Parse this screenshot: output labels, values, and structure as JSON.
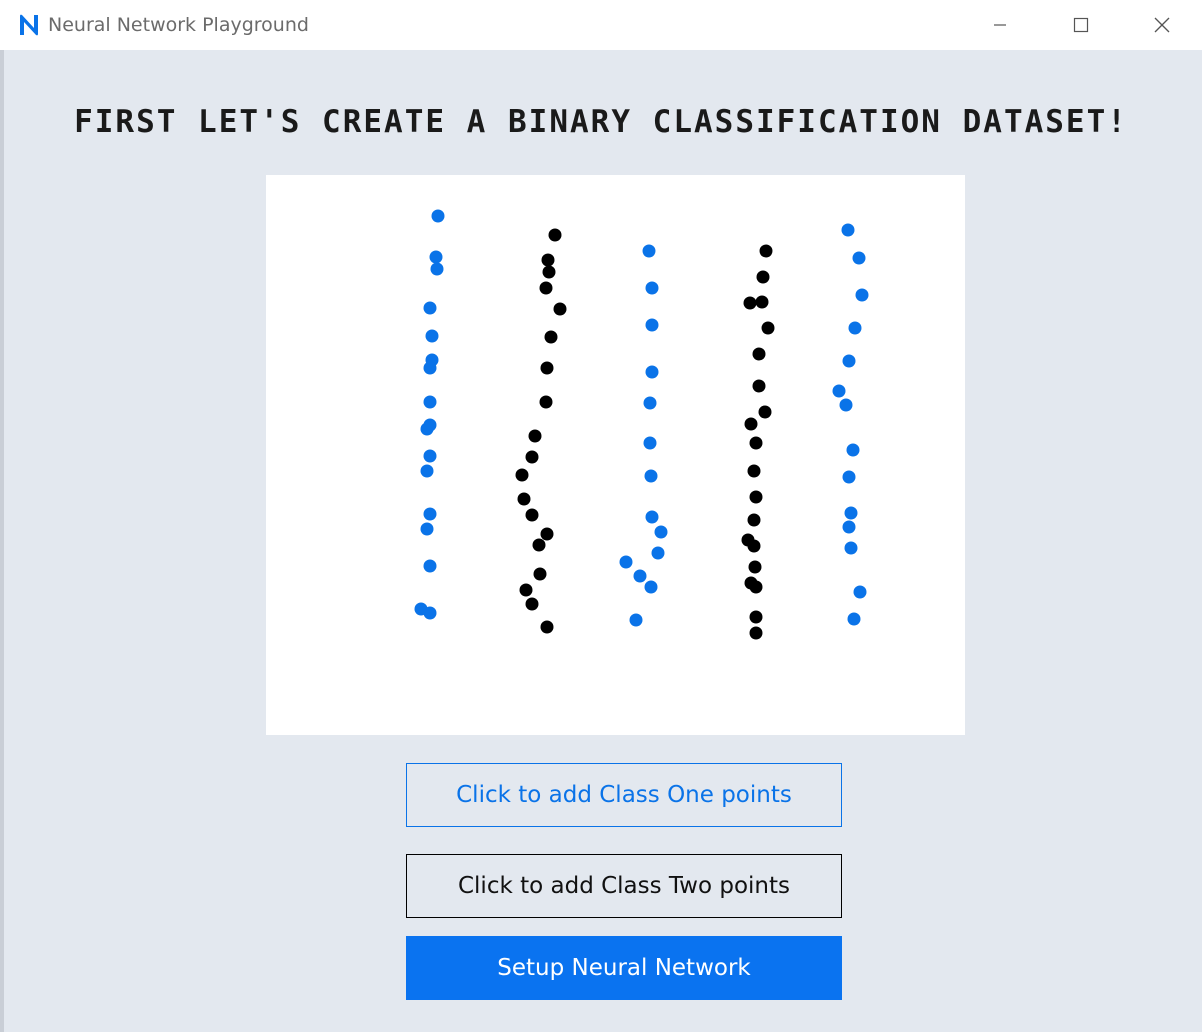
{
  "window": {
    "title": "Neural Network Playground",
    "icon": "app-n-icon",
    "controls": [
      "minimize-icon",
      "maximize-icon",
      "close-icon"
    ]
  },
  "heading": "FIRST LET'S CREATE A BINARY CLASSIFICATION DATASET!",
  "colors": {
    "class_one": "#0a73e8",
    "class_two": "#000000",
    "accent": "#0a73f0",
    "background": "#e3e8ef"
  },
  "dataset": {
    "class_one_points": [
      [
        438,
        216
      ],
      [
        436,
        257
      ],
      [
        437,
        269
      ],
      [
        430,
        308
      ],
      [
        432,
        336
      ],
      [
        432,
        360
      ],
      [
        430,
        368
      ],
      [
        430,
        402
      ],
      [
        430,
        425
      ],
      [
        427,
        429
      ],
      [
        430,
        456
      ],
      [
        427,
        471
      ],
      [
        430,
        514
      ],
      [
        427,
        529
      ],
      [
        430,
        566
      ],
      [
        421,
        609
      ],
      [
        430,
        613
      ],
      [
        649,
        251
      ],
      [
        652,
        288
      ],
      [
        652,
        325
      ],
      [
        652,
        372
      ],
      [
        650,
        403
      ],
      [
        650,
        443
      ],
      [
        651,
        476
      ],
      [
        652,
        517
      ],
      [
        661,
        532
      ],
      [
        658,
        553
      ],
      [
        626,
        562
      ],
      [
        640,
        576
      ],
      [
        651,
        587
      ],
      [
        636,
        620
      ],
      [
        848,
        230
      ],
      [
        859,
        258
      ],
      [
        862,
        295
      ],
      [
        855,
        328
      ],
      [
        849,
        361
      ],
      [
        839,
        391
      ],
      [
        846,
        405
      ],
      [
        853,
        450
      ],
      [
        849,
        477
      ],
      [
        851,
        513
      ],
      [
        849,
        527
      ],
      [
        851,
        548
      ],
      [
        860,
        592
      ],
      [
        854,
        619
      ]
    ],
    "class_two_points": [
      [
        555,
        235
      ],
      [
        548,
        260
      ],
      [
        549,
        272
      ],
      [
        546,
        288
      ],
      [
        560,
        309
      ],
      [
        551,
        337
      ],
      [
        547,
        368
      ],
      [
        546,
        402
      ],
      [
        535,
        436
      ],
      [
        532,
        457
      ],
      [
        522,
        475
      ],
      [
        524,
        499
      ],
      [
        532,
        515
      ],
      [
        547,
        534
      ],
      [
        539,
        545
      ],
      [
        540,
        574
      ],
      [
        526,
        590
      ],
      [
        532,
        604
      ],
      [
        547,
        627
      ],
      [
        766,
        251
      ],
      [
        763,
        277
      ],
      [
        750,
        303
      ],
      [
        762,
        302
      ],
      [
        768,
        328
      ],
      [
        759,
        354
      ],
      [
        759,
        386
      ],
      [
        765,
        412
      ],
      [
        751,
        424
      ],
      [
        756,
        443
      ],
      [
        754,
        471
      ],
      [
        756,
        497
      ],
      [
        754,
        520
      ],
      [
        748,
        540
      ],
      [
        754,
        546
      ],
      [
        755,
        567
      ],
      [
        751,
        583
      ],
      [
        756,
        587
      ],
      [
        756,
        617
      ],
      [
        756,
        633
      ]
    ]
  },
  "buttons": {
    "class_one": "Click to add Class One points",
    "class_two": "Click to add Class Two points",
    "setup": "Setup Neural Network"
  }
}
